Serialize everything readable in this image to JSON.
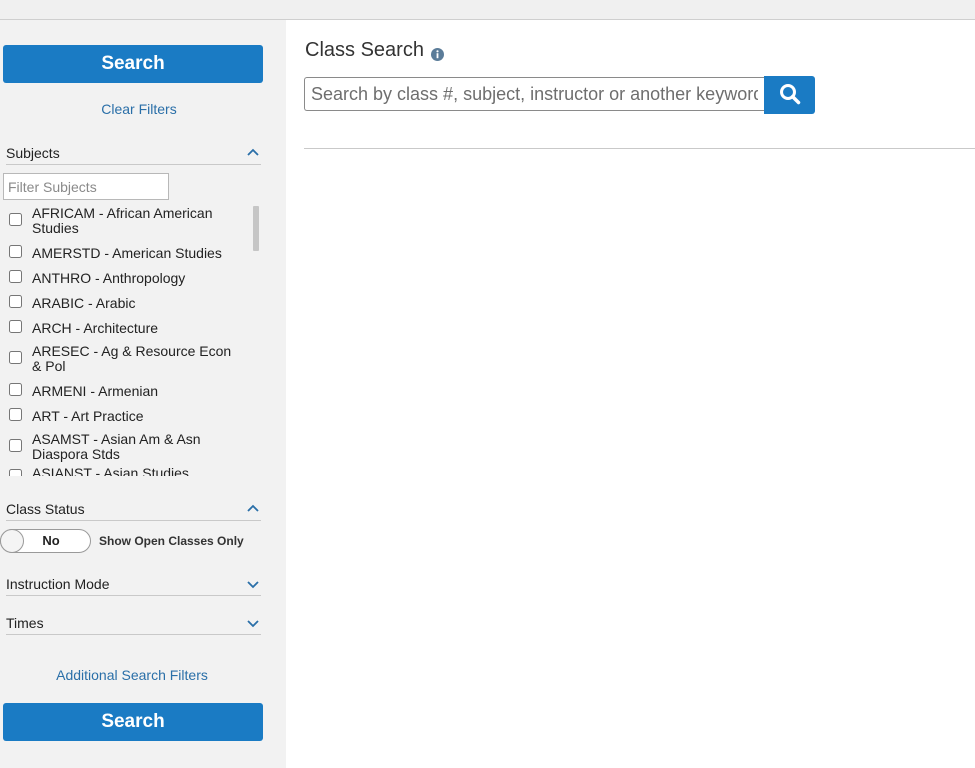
{
  "sidebar": {
    "search_button_top": "Search",
    "clear_filters": "Clear Filters",
    "subjects": {
      "heading": "Subjects",
      "filter_placeholder": "Filter Subjects",
      "items": [
        {
          "label": "AFRICAM - African American Studies",
          "checked": false
        },
        {
          "label": "AMERSTD - American Studies",
          "checked": false
        },
        {
          "label": "ANTHRO - Anthropology",
          "checked": false
        },
        {
          "label": "ARABIC - Arabic",
          "checked": false
        },
        {
          "label": "ARCH - Architecture",
          "checked": false
        },
        {
          "label": "ARESEC - Ag & Resource Econ & Pol",
          "checked": false
        },
        {
          "label": "ARMENI - Armenian",
          "checked": false
        },
        {
          "label": "ART - Art Practice",
          "checked": false
        },
        {
          "label": "ASAMST - Asian Am & Asn Diaspora Stds",
          "checked": false
        },
        {
          "label": "ASIANST - Asian Studies",
          "checked": false
        }
      ]
    },
    "class_status": {
      "heading": "Class Status",
      "toggle_value": "No",
      "toggle_label": "Show Open Classes Only"
    },
    "instruction_mode": {
      "heading": "Instruction Mode"
    },
    "times": {
      "heading": "Times"
    },
    "additional_filters": "Additional Search Filters",
    "search_button_bottom": "Search"
  },
  "main": {
    "title": "Class Search",
    "search_placeholder": "Search by class #, subject, instructor or another keyword"
  },
  "colors": {
    "primary": "#1a7bc4",
    "link": "#2a6fa8",
    "sidebar_bg": "#f2f2f2"
  }
}
